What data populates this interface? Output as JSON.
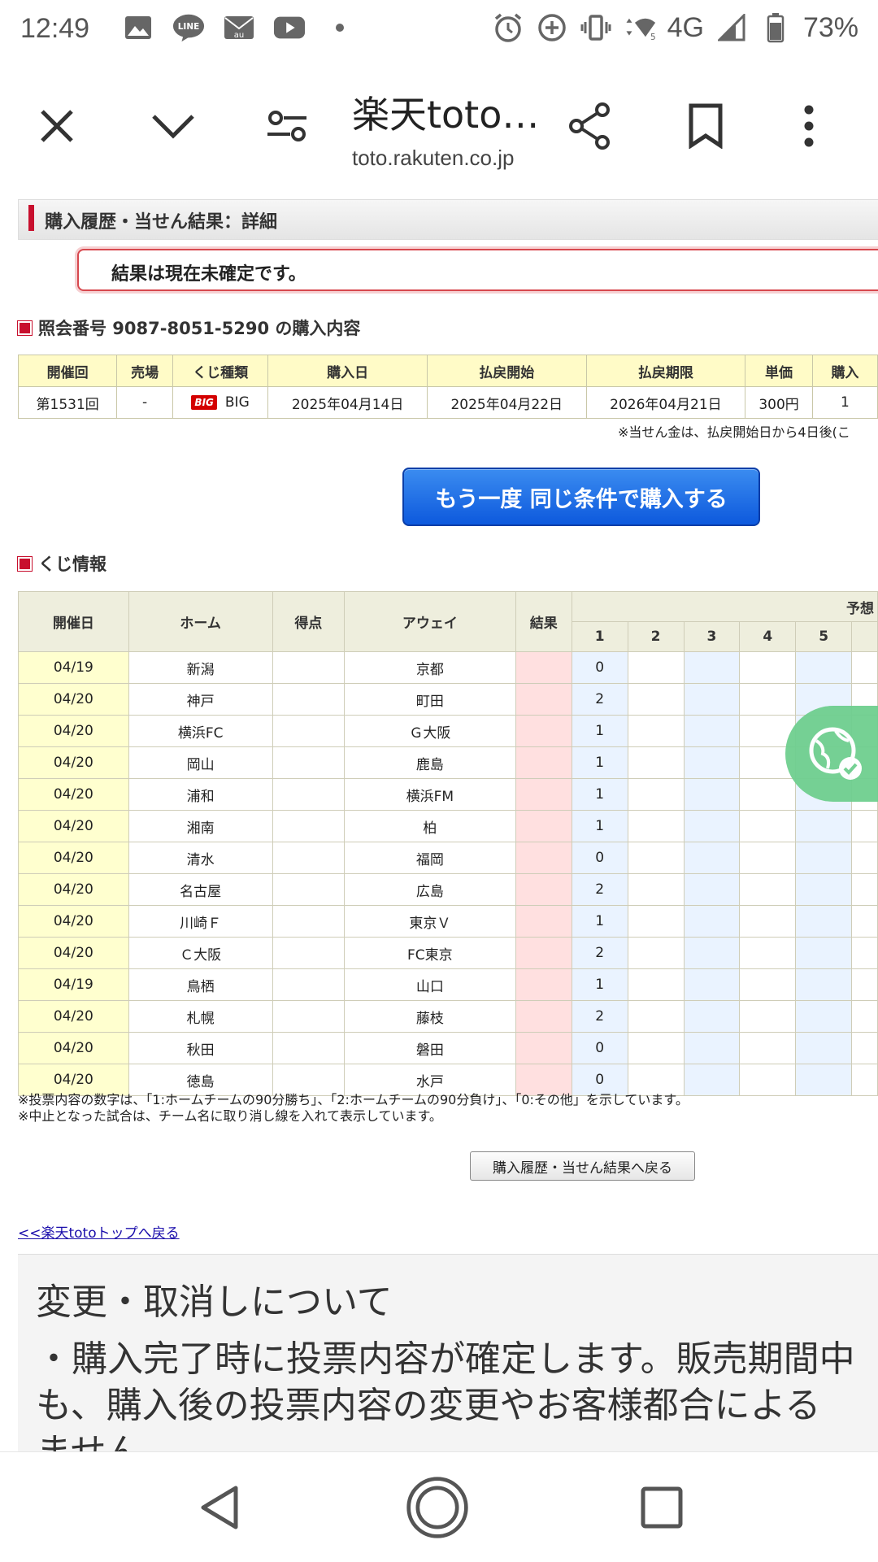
{
  "status_bar": {
    "time": "12:49",
    "network": "4G",
    "battery": "73%",
    "left_icons": [
      "gallery-icon",
      "line-icon",
      "au-mail-icon",
      "youtube-icon",
      "dot-icon"
    ],
    "right_icons": [
      "alarm-icon",
      "data-saver-icon",
      "vibrate-icon",
      "wifi-icon",
      "signal-icon",
      "battery-icon"
    ]
  },
  "toolbar": {
    "title": "楽天toto…",
    "url": "toto.rakuten.co.jp"
  },
  "page": {
    "section_title": "購入履歴・当せん結果：詳細",
    "notice": "結果は現在未確定です。",
    "purchase_heading": "照会番号 9087-8051-5290 の購入内容",
    "purchase_table": {
      "headers": [
        "開催回",
        "売場",
        "くじ種類",
        "購入日",
        "払戻開始",
        "払戻期限",
        "単価",
        "購入"
      ],
      "row": {
        "round": "第1531回",
        "shop": "-",
        "badge": "BIG",
        "kind": "BIG",
        "purchase_date": "2025年04月14日",
        "payout_start": "2025年04月22日",
        "payout_deadline": "2026年04月21日",
        "unit_price": "300円",
        "count": "1"
      }
    },
    "payout_note": "※当せん金は、払戻開始日から4日後(こ",
    "rebuy_button": "もう一度 同じ条件で購入する",
    "lottery_heading": "くじ情報",
    "lottery_table": {
      "headers": {
        "date": "開催日",
        "home": "ホーム",
        "score": "得点",
        "away": "アウェイ",
        "result": "結果",
        "prediction": "予想",
        "cols": [
          "1",
          "2",
          "3",
          "4",
          "5"
        ]
      },
      "rows": [
        {
          "date": "04/19",
          "home": "新潟",
          "away": "京都",
          "pick": "0"
        },
        {
          "date": "04/20",
          "home": "神戸",
          "away": "町田",
          "pick": "2"
        },
        {
          "date": "04/20",
          "home": "横浜FC",
          "away": "Ｇ大阪",
          "pick": "1"
        },
        {
          "date": "04/20",
          "home": "岡山",
          "away": "鹿島",
          "pick": "1"
        },
        {
          "date": "04/20",
          "home": "浦和",
          "away": "横浜FM",
          "pick": "1"
        },
        {
          "date": "04/20",
          "home": "湘南",
          "away": "柏",
          "pick": "1"
        },
        {
          "date": "04/20",
          "home": "清水",
          "away": "福岡",
          "pick": "0"
        },
        {
          "date": "04/20",
          "home": "名古屋",
          "away": "広島",
          "pick": "2"
        },
        {
          "date": "04/20",
          "home": "川崎Ｆ",
          "away": "東京Ｖ",
          "pick": "1"
        },
        {
          "date": "04/20",
          "home": "Ｃ大阪",
          "away": "FC東京",
          "pick": "2"
        },
        {
          "date": "04/19",
          "home": "鳥栖",
          "away": "山口",
          "pick": "1"
        },
        {
          "date": "04/20",
          "home": "札幌",
          "away": "藤枝",
          "pick": "2"
        },
        {
          "date": "04/20",
          "home": "秋田",
          "away": "磐田",
          "pick": "0"
        },
        {
          "date": "04/20",
          "home": "徳島",
          "away": "水戸",
          "pick": "0"
        }
      ]
    },
    "notes": [
      "※投票内容の数字は、「1:ホームチームの90分勝ち」、「2:ホームチームの90分負け」、「0:その他」を示しています。",
      "※中止となった試合は、チーム名に取り消し線を入れて表示しています。"
    ],
    "back_button": "購入履歴・当せん結果へ戻る",
    "top_link": "<<楽天totoトップへ戻る",
    "info_heading": "変更・取消しについて",
    "info_line1": "・購入完了時に投票内容が確定します。販売期間中",
    "info_line2": "も、購入後の投票内容の変更やお客様都合による",
    "info_line3": "ません"
  },
  "colors": {
    "accent_red": "#c8102e",
    "button_blue": "#0d59dd",
    "header_yellow": "#fffbc7",
    "result_pink": "#ffe0e0",
    "pick_blue": "#eaf3ff"
  }
}
